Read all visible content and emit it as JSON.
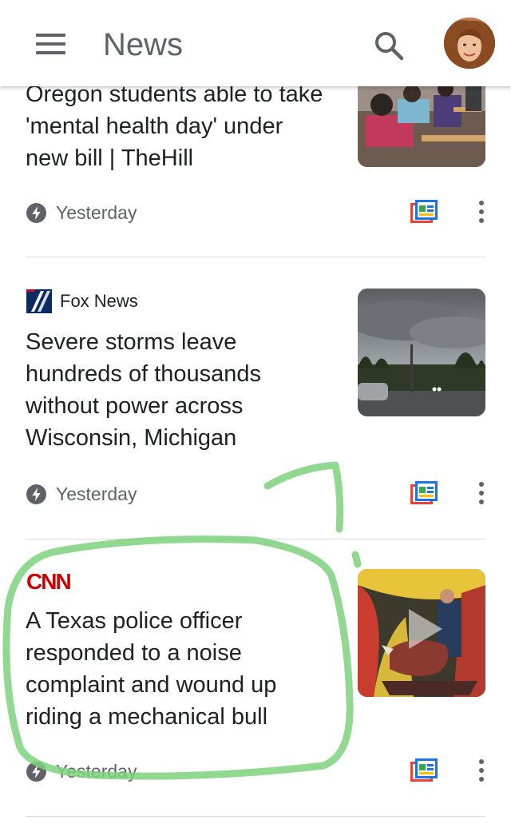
{
  "header": {
    "title": "News",
    "menu_icon": "hamburger-menu-icon",
    "search_icon": "search-icon",
    "avatar_icon": "user-avatar"
  },
  "articles": [
    {
      "source": "",
      "headline": "Oregon students able to take 'mental health day' under new bill | TheHill",
      "time": "Yesterday"
    },
    {
      "source": "Fox News",
      "headline": "Severe storms leave hundreds of thousands without power across Wisconsin, Michigan",
      "time": "Yesterday"
    },
    {
      "source": "CNN",
      "headline": "A Texas police officer responded to a noise complaint and wound up riding a mechanical bull",
      "time": "Yesterday"
    }
  ],
  "icons": {
    "time": "lightning-bolt-icon",
    "full_coverage": "full-coverage-icon",
    "more": "more-vert-icon",
    "play": "play-icon"
  },
  "colors": {
    "text_primary": "#202124",
    "text_secondary": "#5f6368",
    "divider": "#dadce0",
    "annotation_green": "#7ed17e",
    "cnn_red": "#cc0000",
    "fox_blue": "#0a2c63"
  }
}
